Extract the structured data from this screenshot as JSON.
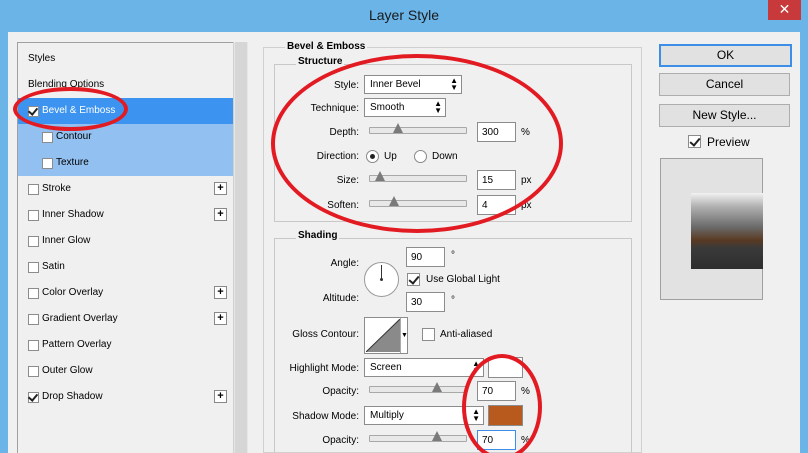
{
  "window": {
    "title": "Layer Style",
    "close_glyph": "✕"
  },
  "left_panel": {
    "items": [
      {
        "label": "Styles",
        "checkbox": false,
        "checked": false,
        "plus": false
      },
      {
        "label": "Blending Options",
        "checkbox": false,
        "checked": false,
        "plus": false
      },
      {
        "label": "Bevel & Emboss",
        "checkbox": true,
        "checked": true,
        "plus": false,
        "selected": true
      },
      {
        "label": "Contour",
        "checkbox": true,
        "checked": false,
        "plus": false,
        "sub": true
      },
      {
        "label": "Texture",
        "checkbox": true,
        "checked": false,
        "plus": false,
        "sub": true
      },
      {
        "label": "Stroke",
        "checkbox": true,
        "checked": false,
        "plus": true
      },
      {
        "label": "Inner Shadow",
        "checkbox": true,
        "checked": false,
        "plus": true
      },
      {
        "label": "Inner Glow",
        "checkbox": true,
        "checked": false,
        "plus": false
      },
      {
        "label": "Satin",
        "checkbox": true,
        "checked": false,
        "plus": false
      },
      {
        "label": "Color Overlay",
        "checkbox": true,
        "checked": false,
        "plus": true
      },
      {
        "label": "Gradient Overlay",
        "checkbox": true,
        "checked": false,
        "plus": true
      },
      {
        "label": "Pattern Overlay",
        "checkbox": true,
        "checked": false,
        "plus": false
      },
      {
        "label": "Outer Glow",
        "checkbox": true,
        "checked": false,
        "plus": false
      },
      {
        "label": "Drop Shadow",
        "checkbox": true,
        "checked": true,
        "plus": true
      }
    ],
    "plus_glyph": "+"
  },
  "bevel": {
    "section_title": "Bevel & Emboss",
    "structure_title": "Structure",
    "style_label": "Style:",
    "style_value": "Inner Bevel",
    "technique_label": "Technique:",
    "technique_value": "Smooth",
    "depth_label": "Depth:",
    "depth_value": "300",
    "depth_unit": "%",
    "depth_slider": 0.29,
    "direction_label": "Direction:",
    "direction_up": "Up",
    "direction_down": "Down",
    "direction_selected": "Up",
    "size_label": "Size:",
    "size_value": "15",
    "size_unit": "px",
    "size_slider": 0.1,
    "soften_label": "Soften:",
    "soften_value": "4",
    "soften_unit": "px",
    "soften_slider": 0.25
  },
  "shading": {
    "title": "Shading",
    "angle_label": "Angle:",
    "angle_value": "90",
    "angle_unit": "°",
    "use_global_light_label": "Use Global Light",
    "use_global_light": true,
    "altitude_label": "Altitude:",
    "altitude_value": "30",
    "altitude_unit": "°",
    "gloss_contour_label": "Gloss Contour:",
    "anti_aliased_label": "Anti-aliased",
    "anti_aliased": false,
    "highlight_mode_label": "Highlight Mode:",
    "highlight_mode_value": "Screen",
    "highlight_color": "#ffffff",
    "highlight_opacity_label": "Opacity:",
    "highlight_opacity_value": "70",
    "highlight_opacity_unit": "%",
    "highlight_opacity_slider": 0.7,
    "shadow_mode_label": "Shadow Mode:",
    "shadow_mode_value": "Multiply",
    "shadow_color": "#b85a1e",
    "shadow_opacity_label": "Opacity:",
    "shadow_opacity_value": "70",
    "shadow_opacity_unit": "%",
    "shadow_opacity_slider": 0.7
  },
  "buttons": {
    "ok": "OK",
    "cancel": "Cancel",
    "new_style": "New Style...",
    "preview_label": "Preview",
    "preview_checked": true
  },
  "colors": {
    "title_bar": "#6ab4e8",
    "selection": "#3c94f0",
    "annotation": "#e21b23"
  }
}
